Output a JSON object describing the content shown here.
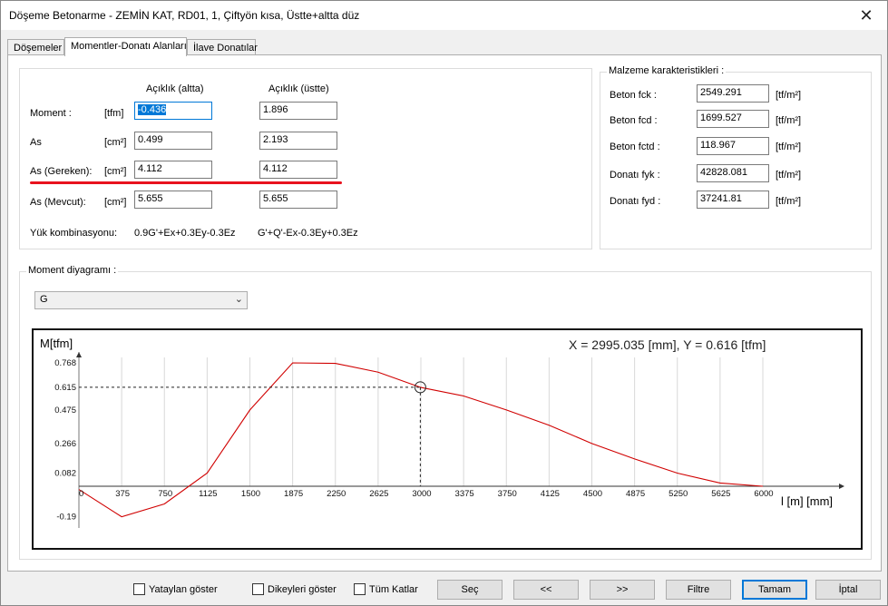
{
  "window": {
    "title": "Döşeme Betonarme - ZEMİN KAT, RD01, 1, Çiftyön kısa, Üstte+altta düz",
    "close_glyph": "✕"
  },
  "tabs": [
    {
      "label": "Döşemeler"
    },
    {
      "label": "Momentler-Donatı Alanları"
    },
    {
      "label": "İlave Donatılar"
    }
  ],
  "moments": {
    "col_bottom": "Açıklık (altta)",
    "col_top": "Açıklık (üstte)",
    "rows": [
      {
        "label": "Moment :",
        "unit": "[tfm]",
        "bottom": "-0.436",
        "top": "1.896"
      },
      {
        "label": "As",
        "unit": "[cm²]",
        "bottom": "0.499",
        "top": "2.193"
      },
      {
        "label": "As (Gereken):",
        "unit": "[cm²]",
        "bottom": "4.112",
        "top": "4.112"
      },
      {
        "label": "As (Mevcut):",
        "unit": "[cm²]",
        "bottom": "5.655",
        "top": "5.655"
      }
    ],
    "combo_label": "Yük kombinasyonu:",
    "combo_bottom": "0.9G'+Ex+0.3Ey-0.3Ez",
    "combo_top": "G'+Q'-Ex-0.3Ey+0.3Ez"
  },
  "material": {
    "title": "Malzeme karakteristikleri :",
    "rows": [
      {
        "label": "Beton fck :",
        "value": "2549.291",
        "unit": "[tf/m²]"
      },
      {
        "label": "Beton fcd :",
        "value": "1699.527",
        "unit": "[tf/m²]"
      },
      {
        "label": "Beton fctd :",
        "value": "118.967",
        "unit": "[tf/m²]"
      },
      {
        "label": "Donatı fyk :",
        "value": "42828.081",
        "unit": "[tf/m²]"
      },
      {
        "label": "Donatı fyd :",
        "value": "37241.81",
        "unit": "[tf/m²]"
      }
    ]
  },
  "diagram": {
    "title": "Moment diyagramı :",
    "selected_case": "G",
    "readout": "X = 2995.035 [mm],  Y = 0.616 [tfm]"
  },
  "chart_data": {
    "type": "line",
    "ylabel": "M[tfm]",
    "xlabel": "l [m] [mm]",
    "x_ticks": [
      "0",
      "375",
      "750",
      "1125",
      "1500",
      "1875",
      "2250",
      "2625",
      "3000",
      "3375",
      "3750",
      "4125",
      "4500",
      "4875",
      "5250",
      "5625",
      "6000"
    ],
    "y_ticks": [
      "0.768",
      "0.615",
      "0.475",
      "0.266",
      "0.082",
      "-0.19"
    ],
    "y_tick_values": [
      0.768,
      0.615,
      0.475,
      0.266,
      0.082,
      -0.19
    ],
    "xlim": [
      0,
      6000
    ],
    "ylim": [
      -0.19,
      0.85
    ],
    "series": [
      {
        "color": "#d00000",
        "x": [
          0,
          375,
          750,
          1125,
          1500,
          1875,
          2250,
          2625,
          3000,
          3375,
          3750,
          4125,
          4500,
          4875,
          5250,
          5625,
          6000
        ],
        "y": [
          -0.02,
          -0.19,
          -0.11,
          0.082,
          0.475,
          0.768,
          0.765,
          0.71,
          0.615,
          0.562,
          0.475,
          0.38,
          0.266,
          0.17,
          0.082,
          0.02,
          0.0
        ]
      }
    ],
    "cursor": {
      "x": 2995.035,
      "y": 0.616
    },
    "grid": "vertical"
  },
  "bottom": {
    "chk_horizontal": "Yataylan göster",
    "chk_vertical": "Dikeyleri göster",
    "chk_all_floors": "Tüm Katlar",
    "btn_select": "Seç",
    "btn_prev": "<<",
    "btn_next": ">>",
    "btn_filter": "Filtre",
    "btn_ok": "Tamam",
    "btn_cancel": "İptal"
  }
}
